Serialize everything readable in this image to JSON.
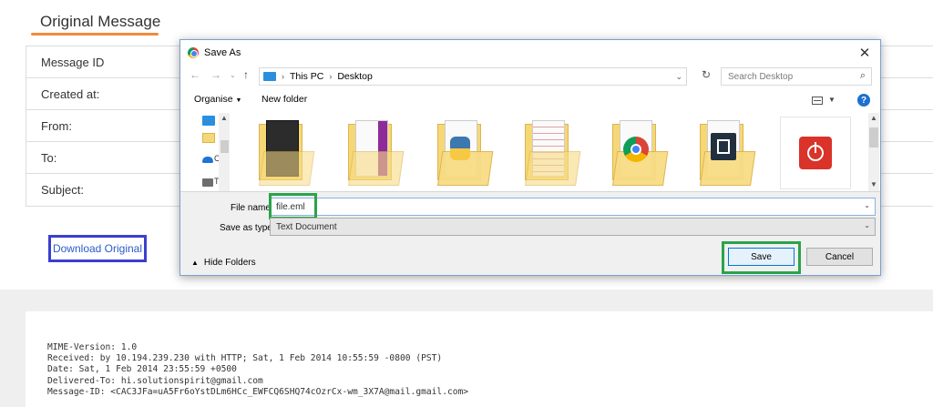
{
  "page": {
    "title": "Original Message",
    "fields": [
      {
        "label": "Message ID"
      },
      {
        "label": "Created at:"
      },
      {
        "label": "From:"
      },
      {
        "label": "To:"
      },
      {
        "label": "Subject:"
      }
    ],
    "download_label": "Download Original",
    "raw_lines": [
      "MIME-Version: 1.0",
      "Received: by 10.194.239.230 with HTTP; Sat, 1 Feb 2014 10:55:59 -0800 (PST)",
      "Date: Sat, 1 Feb 2014 23:55:59 +0500",
      "Delivered-To: hi.solutionspirit@gmail.com",
      "Message-ID: <CAC3JFa=uA5Fr6oYstDLm6HCc_EWFCQ6SHQ74cOzrCx-wm_3X7A@mail.gmail.com>"
    ],
    "accent_color": "#f08a3c"
  },
  "dialog": {
    "title": "Save As",
    "breadcrumb": [
      "This PC",
      "Desktop"
    ],
    "search_placeholder": "Search Desktop",
    "toolbar": {
      "organise": "Organise",
      "new_folder": "New folder",
      "help": "?"
    },
    "nav_pane_labels": [
      "C",
      "T"
    ],
    "file_name_label": "File name:",
    "file_name_value": "file.eml",
    "save_as_type_label": "Save as type:",
    "save_as_type_value": "Text Document",
    "hide_folders_label": "Hide Folders",
    "save_label": "Save",
    "cancel_label": "Cancel",
    "highlight_color": "#2ba34a",
    "files": [
      {
        "icon": "dark-terminal-folder-icon"
      },
      {
        "icon": "purple-folder-icon"
      },
      {
        "icon": "python-folder-icon"
      },
      {
        "icon": "document-folder-icon"
      },
      {
        "icon": "chrome-folder-icon"
      },
      {
        "icon": "brackets-folder-icon"
      },
      {
        "icon": "power-app-icon"
      }
    ]
  }
}
